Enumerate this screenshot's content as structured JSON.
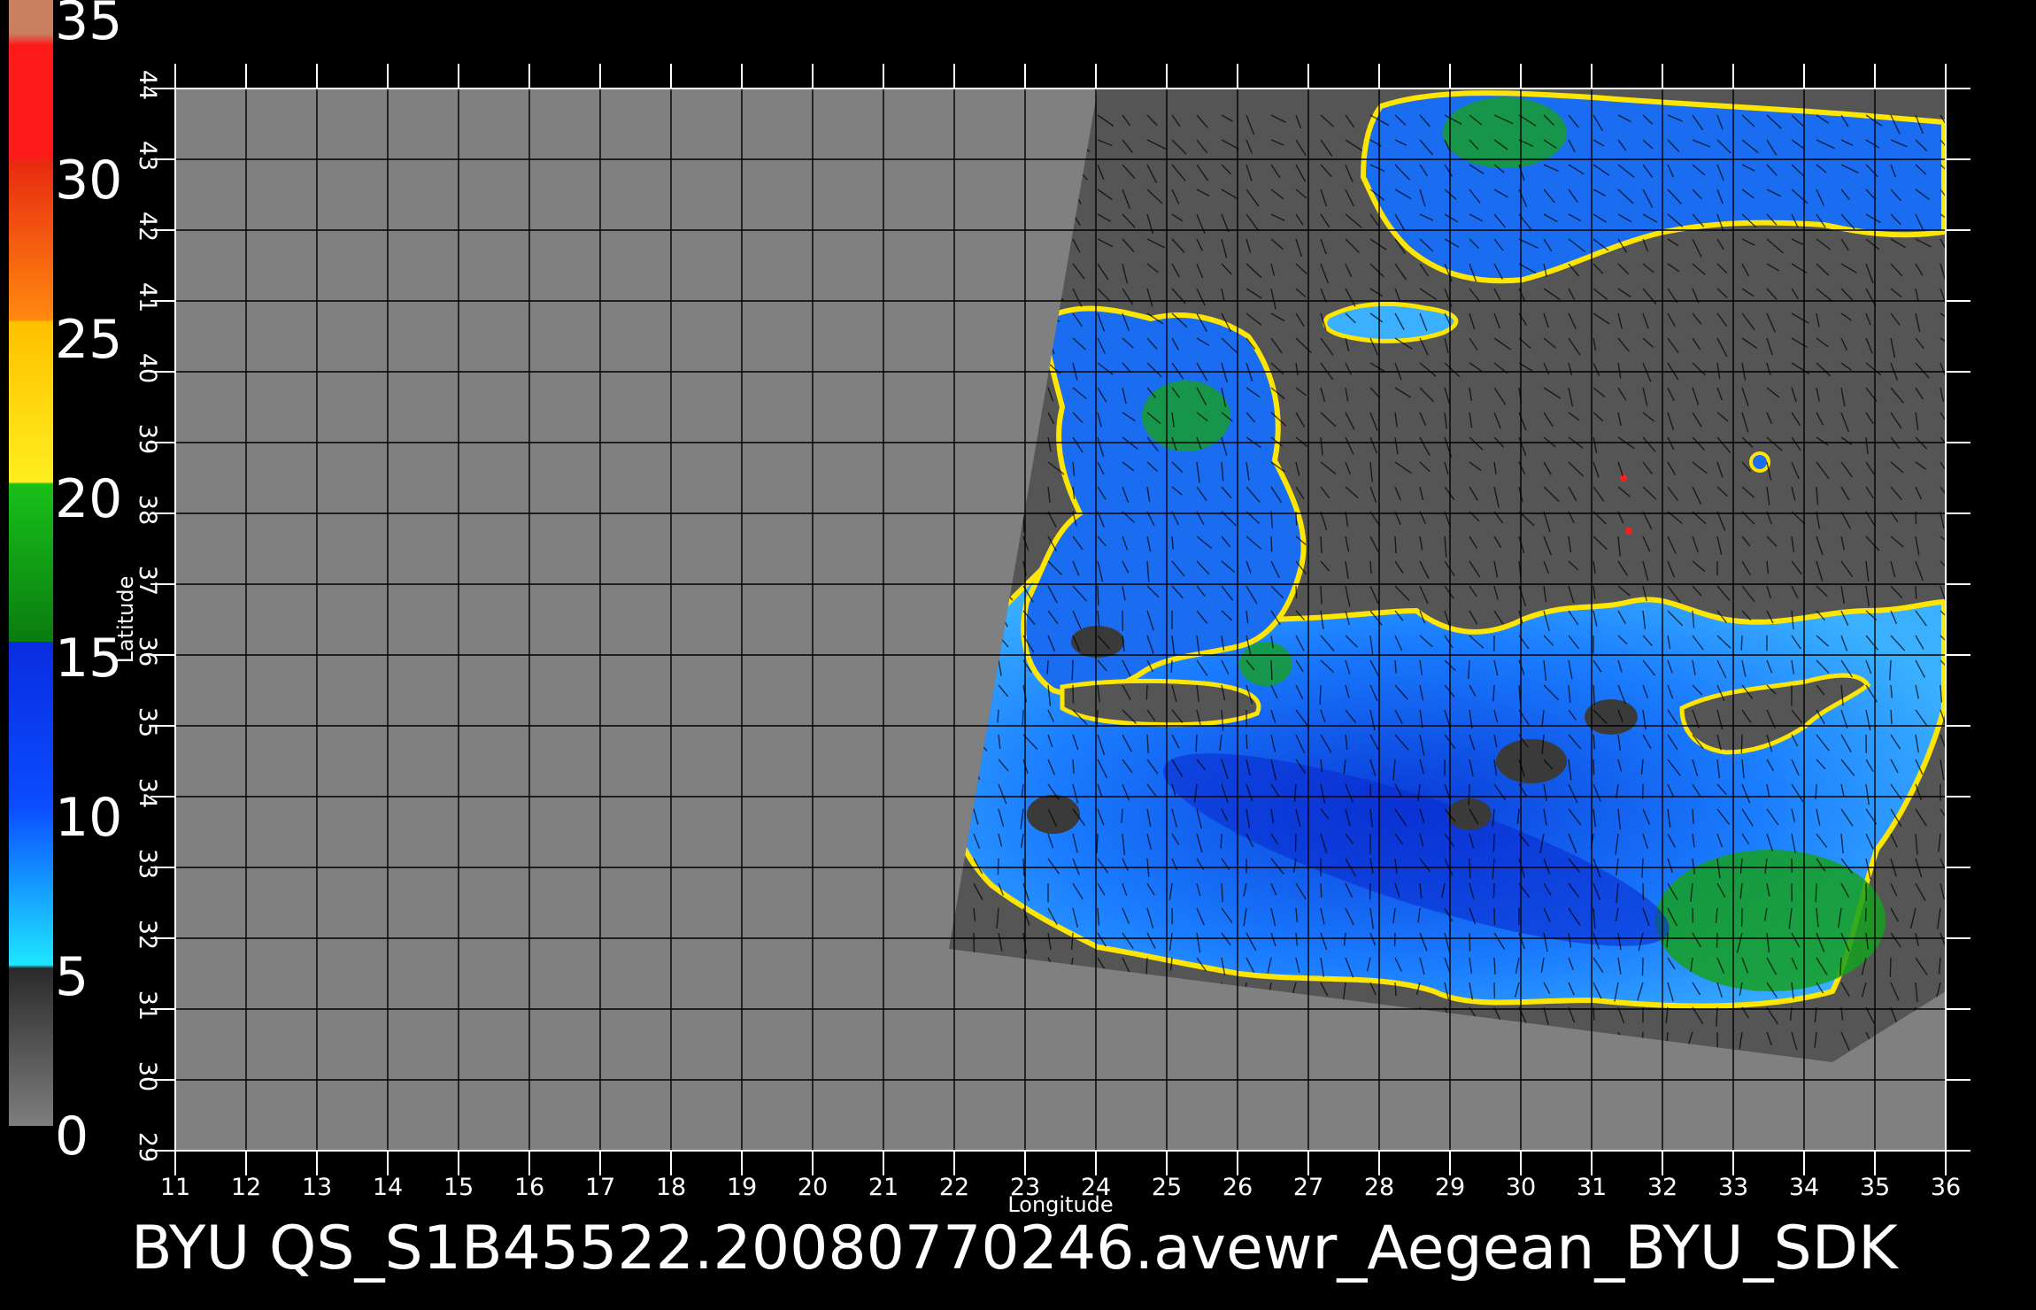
{
  "colorbar": {
    "ticks": [
      "0",
      "5",
      "10",
      "15",
      "20",
      "25",
      "30",
      "35"
    ],
    "bands": [
      "#7e7e7e",
      "#1ee6ff",
      "#0b4cff",
      "#0a7c10",
      "#ffee20",
      "#ff6a10",
      "#ff1a1a",
      "#c88060"
    ]
  },
  "map": {
    "lon_ticks": [
      "11",
      "12",
      "13",
      "14",
      "15",
      "16",
      "17",
      "18",
      "19",
      "20",
      "21",
      "22",
      "23",
      "24",
      "25",
      "26",
      "27",
      "28",
      "29",
      "30",
      "31",
      "32",
      "33",
      "34",
      "35",
      "36"
    ],
    "lat_ticks": [
      "29",
      "30",
      "31",
      "32",
      "33",
      "34",
      "35",
      "36",
      "37",
      "38",
      "39",
      "40",
      "41",
      "42",
      "43",
      "44"
    ],
    "xlabel": "Longitude",
    "ylabel": "Latitude",
    "background_color": "#808080",
    "swath_color": "#555555",
    "ocean_colors": [
      "#1a7cff",
      "#0a3cd8",
      "#3ab0ff",
      "#16a020",
      "#ffe600",
      "#ff2020"
    ]
  },
  "caption": "BYU QS_S1B45522.20080770246.avewr_Aegean_BYU_SDK"
}
